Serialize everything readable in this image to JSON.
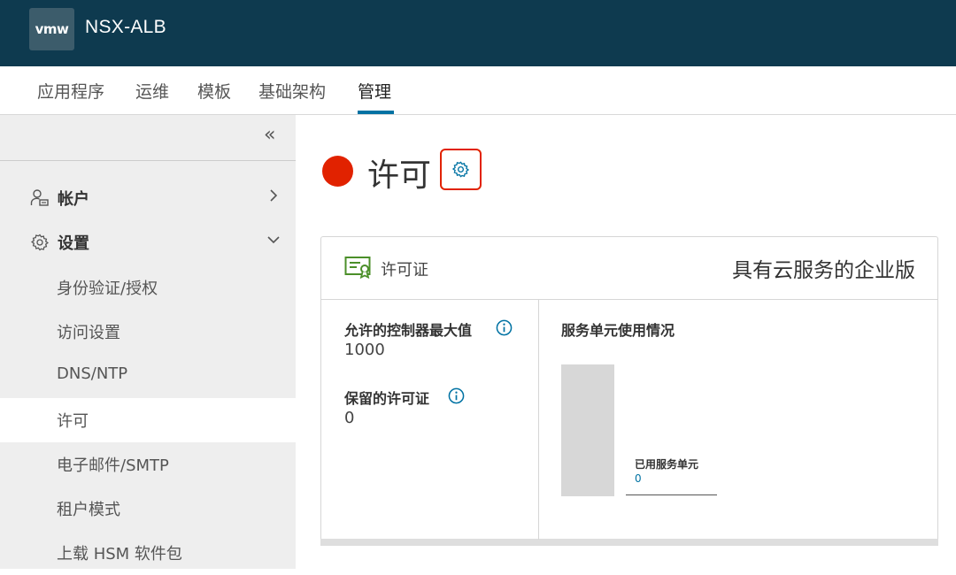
{
  "header": {
    "logo": "vmw",
    "app_title": "NSX-ALB"
  },
  "tabs": [
    {
      "label": "应用程序",
      "active": false
    },
    {
      "label": "运维",
      "active": false
    },
    {
      "label": "模板",
      "active": false
    },
    {
      "label": "基础架构",
      "active": false
    },
    {
      "label": "管理",
      "active": true
    }
  ],
  "sidebar": {
    "collapse_glyph": "«",
    "groups": [
      {
        "label": "帐户",
        "icon": "user-group-icon",
        "chevron": "right"
      },
      {
        "label": "设置",
        "icon": "gear-icon",
        "chevron": "down"
      }
    ],
    "items": [
      {
        "label": "身份验证/授权",
        "active": false
      },
      {
        "label": "访问设置",
        "active": false
      },
      {
        "label": "DNS/NTP",
        "active": false
      },
      {
        "label": "许可",
        "active": true
      },
      {
        "label": "电子邮件/SMTP",
        "active": false
      },
      {
        "label": "租户模式",
        "active": false
      },
      {
        "label": "上载 HSM 软件包",
        "active": false
      }
    ]
  },
  "main": {
    "status_color": "#e12200",
    "title": "许可",
    "license_card": {
      "title": "许可证",
      "edition": "具有云服务的企业版",
      "fields": [
        {
          "label": "允许的控制器最大值",
          "value": "1000"
        },
        {
          "label": "保留的许可证",
          "value": "0"
        }
      ],
      "service_units": {
        "title": "服务单元使用情况",
        "legend_label": "已用服务单元",
        "legend_value": "0"
      }
    }
  },
  "colors": {
    "header_bg": "#0e3a4f",
    "accent": "#0072a3",
    "alert": "#e12200",
    "cert_green": "#4b8f29"
  }
}
